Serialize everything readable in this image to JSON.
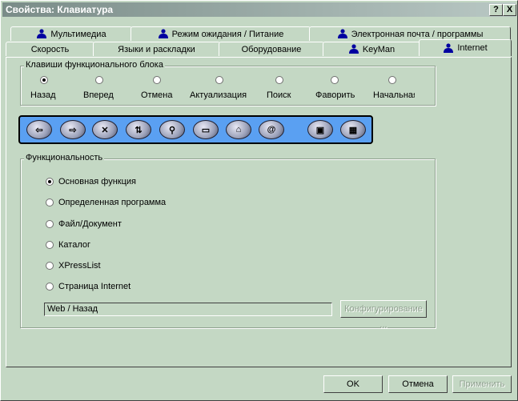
{
  "window": {
    "title": "Свойства: Клавиатура",
    "help": "?",
    "close": "X"
  },
  "tabs_back": [
    {
      "label": "Мультимедиа",
      "icon": "user-icon"
    },
    {
      "label": "Режим ожидания / Питание",
      "icon": "user-icon"
    },
    {
      "label": "Электронная почта / программы",
      "icon": "user-icon"
    }
  ],
  "tabs_front": [
    {
      "label": "Скорость"
    },
    {
      "label": "Языки и раскладки"
    },
    {
      "label": "Оборудование"
    },
    {
      "label": "KeyMan",
      "icon": "user-icon"
    },
    {
      "label": "Internet",
      "icon": "user-icon",
      "active": true
    }
  ],
  "keys_group": {
    "title": "Клавиши функционального блока",
    "options": [
      {
        "label": "Назад",
        "checked": true
      },
      {
        "label": "Вперед",
        "checked": false
      },
      {
        "label": "Отмена",
        "checked": false
      },
      {
        "label": "Актуализация",
        "checked": false
      },
      {
        "label": "Поиск",
        "checked": false
      },
      {
        "label": "Фаворить",
        "checked": false
      },
      {
        "label": "Начальная",
        "checked": false
      }
    ]
  },
  "key_strip": {
    "keys": [
      {
        "name": "back-key",
        "glyph": "⇦"
      },
      {
        "name": "forward-key",
        "glyph": "⇨"
      },
      {
        "name": "stop-key",
        "glyph": "✕"
      },
      {
        "name": "refresh-key",
        "glyph": "⇅"
      },
      {
        "name": "search-key",
        "glyph": "⚲"
      },
      {
        "name": "favorites-key",
        "glyph": "▭"
      },
      {
        "name": "home-key",
        "glyph": "⌂"
      },
      {
        "name": "mail-key",
        "glyph": "@"
      },
      {
        "name": "computer-key",
        "glyph": "▣"
      },
      {
        "name": "calculator-key",
        "glyph": "▦"
      }
    ]
  },
  "func_group": {
    "title": "Функциональность",
    "options": [
      {
        "label": "Основная функция",
        "checked": true
      },
      {
        "label": "Определенная программа",
        "checked": false
      },
      {
        "label": "Файл/Документ",
        "checked": false
      },
      {
        "label": "Каталог",
        "checked": false
      },
      {
        "label": "XPressList",
        "checked": false
      },
      {
        "label": "Страница Internet",
        "checked": false
      }
    ],
    "value": "Web / Назад",
    "configure": "Конфигурирование ..."
  },
  "buttons": {
    "ok": "OK",
    "cancel": "Отмена",
    "apply": "Применить"
  }
}
